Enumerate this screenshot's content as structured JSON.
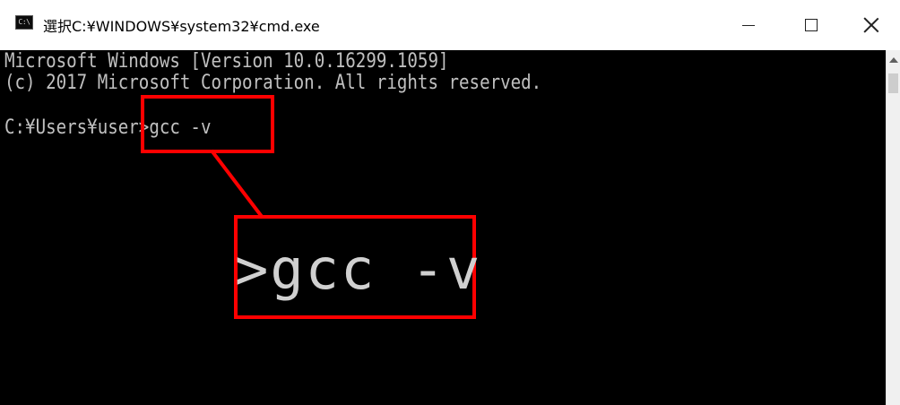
{
  "window": {
    "title": "選択C:¥WINDOWS¥system32¥cmd.exe",
    "icon": "console-icon",
    "icon_label": "C:\\"
  },
  "controls": {
    "minimize_icon": "minimize-icon",
    "maximize_icon": "maximize-icon",
    "close_icon": "close-icon"
  },
  "console": {
    "lines": [
      "Microsoft Windows [Version 10.0.16299.1059]",
      "(c) 2017 Microsoft Corporation. All rights reserved.",
      "",
      "C:¥Users¥user>gcc -v"
    ],
    "background": "#000000",
    "foreground": "#c0c0c0"
  },
  "annotation": {
    "zoom_text": ">gcc -v",
    "color": "#ff0000"
  }
}
